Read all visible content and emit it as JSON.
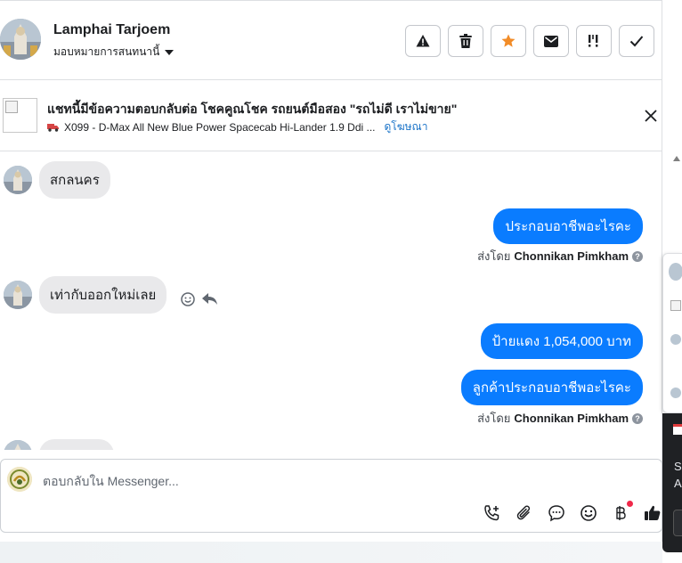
{
  "header": {
    "name": "Lamphai Tarjoem",
    "assign_label": "มอบหมายการสนทนานี้",
    "actions": [
      {
        "name": "report-button",
        "icon": "warning-icon"
      },
      {
        "name": "delete-button",
        "icon": "trash-icon"
      },
      {
        "name": "star-button",
        "icon": "star-icon"
      },
      {
        "name": "mark-unread-button",
        "icon": "envelope-icon"
      },
      {
        "name": "follow-up-button",
        "icon": "exclamation-icon"
      },
      {
        "name": "done-button",
        "icon": "check-icon"
      }
    ]
  },
  "ad": {
    "title": "แชทนี้มีข้อความตอบกลับต่อ โชคคูณโชค รถยนต์มือสอง \"รถไม่ดี เราไม่ขาย\"",
    "subtitle": "X099 - D-Max All New Blue Power Spacecab Hi-Lander 1.9 Ddi ...",
    "link": "ดูโฆษณา"
  },
  "messages": {
    "in1": "สกลนคร",
    "out1": "ประกอบอาชีพอะไรคะ",
    "sent_prefix": "ส่งโดย",
    "sent_by": "Chonnikan Pimkham",
    "in2": "เท่ากับออกใหม่เลย",
    "out2": "ป้ายแดง 1,054,000 บาท",
    "out3": "ลูกค้าประกอบอาชีพอะไรคะ"
  },
  "composer": {
    "placeholder": "ตอบกลับใน Messenger..."
  },
  "side": {
    "letter1": "S",
    "letter2": "A"
  },
  "colors": {
    "accent": "#0a7cff",
    "star": "#f28c28",
    "link": "#1a73c8"
  }
}
